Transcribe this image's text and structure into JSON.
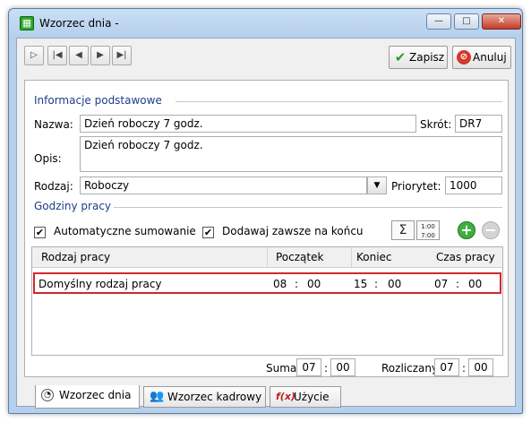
{
  "window": {
    "title": "Wzorzec dnia -",
    "app_icon": "calendar-green-icon",
    "caption_buttons": {
      "minimize": "—",
      "maximize": "□",
      "close": "✕"
    }
  },
  "toolbar": {
    "nav_icons": [
      "new-record-icon",
      "first-record-icon",
      "previous-record-icon",
      "next-record-icon",
      "last-record-icon"
    ],
    "nav_glyphs": [
      "▷",
      "|◀",
      "◀",
      "▶",
      "▶|"
    ],
    "save_label": "Zapisz",
    "cancel_label": "Anuluj"
  },
  "basic_info": {
    "section_title": "Informacje podstawowe",
    "name_label": "Nazwa:",
    "name_value": "Dzień roboczy 7 godz.",
    "abbr_label": "Skrót:",
    "abbr_value": "DR7",
    "desc_label": "Opis:",
    "desc_value": "Dzień roboczy 7 godz.",
    "type_label": "Rodzaj:",
    "type_value": "Roboczy",
    "priority_label": "Priorytet:",
    "priority_value": "1000"
  },
  "work_hours": {
    "section_title": "Godziny pracy",
    "auto_sum_label": "Automatyczne sumowanie",
    "auto_sum_checked": true,
    "append_end_label": "Dodawaj zawsze na końcu",
    "append_end_checked": true,
    "tool_sum_text": "Σ",
    "tool_time_text": "1:00\n7:00",
    "add_glyph": "+",
    "remove_glyph": "−",
    "columns": [
      "Rodzaj pracy",
      "Początek",
      "Koniec",
      "Czas pracy"
    ],
    "rows": [
      {
        "type": "Domyślny rodzaj pracy",
        "start_h": "08",
        "start_m": "00",
        "end_h": "15",
        "end_m": "00",
        "dur_h": "07",
        "dur_m": "00"
      }
    ],
    "colon": ":",
    "sum_label": "Suma",
    "sum_h": "07",
    "sum_m": "00",
    "settled_label": "Rozliczany",
    "settled_h": "07",
    "settled_m": "00"
  },
  "tabs": [
    {
      "label": "Wzorzec dnia",
      "icon": "clock-icon",
      "active": true
    },
    {
      "label": "Wzorzec kadrowy",
      "icon": "people-icon",
      "active": false
    },
    {
      "label": "Użycie",
      "icon": "function-icon",
      "active": false
    }
  ],
  "colors": {
    "section_title": "#1e3c8c",
    "highlight_border": "#d1282e",
    "save_check": "#2e9e2e",
    "cancel_icon": "#d23a2a"
  }
}
